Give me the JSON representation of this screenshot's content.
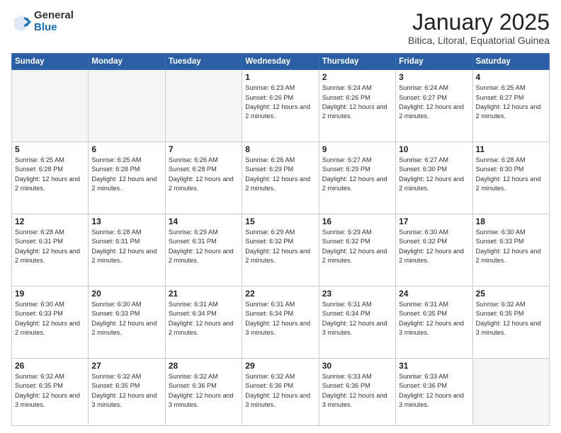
{
  "logo": {
    "general": "General",
    "blue": "Blue"
  },
  "header": {
    "month": "January 2025",
    "location": "Bitica, Litoral, Equatorial Guinea"
  },
  "days_of_week": [
    "Sunday",
    "Monday",
    "Tuesday",
    "Wednesday",
    "Thursday",
    "Friday",
    "Saturday"
  ],
  "weeks": [
    [
      {
        "day": "",
        "info": ""
      },
      {
        "day": "",
        "info": ""
      },
      {
        "day": "",
        "info": ""
      },
      {
        "day": "1",
        "info": "Sunrise: 6:23 AM\nSunset: 6:26 PM\nDaylight: 12 hours and 2 minutes."
      },
      {
        "day": "2",
        "info": "Sunrise: 6:24 AM\nSunset: 6:26 PM\nDaylight: 12 hours and 2 minutes."
      },
      {
        "day": "3",
        "info": "Sunrise: 6:24 AM\nSunset: 6:27 PM\nDaylight: 12 hours and 2 minutes."
      },
      {
        "day": "4",
        "info": "Sunrise: 6:25 AM\nSunset: 6:27 PM\nDaylight: 12 hours and 2 minutes."
      }
    ],
    [
      {
        "day": "5",
        "info": "Sunrise: 6:25 AM\nSunset: 6:28 PM\nDaylight: 12 hours and 2 minutes."
      },
      {
        "day": "6",
        "info": "Sunrise: 6:25 AM\nSunset: 6:28 PM\nDaylight: 12 hours and 2 minutes."
      },
      {
        "day": "7",
        "info": "Sunrise: 6:26 AM\nSunset: 6:28 PM\nDaylight: 12 hours and 2 minutes."
      },
      {
        "day": "8",
        "info": "Sunrise: 6:26 AM\nSunset: 6:29 PM\nDaylight: 12 hours and 2 minutes."
      },
      {
        "day": "9",
        "info": "Sunrise: 6:27 AM\nSunset: 6:29 PM\nDaylight: 12 hours and 2 minutes."
      },
      {
        "day": "10",
        "info": "Sunrise: 6:27 AM\nSunset: 6:30 PM\nDaylight: 12 hours and 2 minutes."
      },
      {
        "day": "11",
        "info": "Sunrise: 6:28 AM\nSunset: 6:30 PM\nDaylight: 12 hours and 2 minutes."
      }
    ],
    [
      {
        "day": "12",
        "info": "Sunrise: 6:28 AM\nSunset: 6:31 PM\nDaylight: 12 hours and 2 minutes."
      },
      {
        "day": "13",
        "info": "Sunrise: 6:28 AM\nSunset: 6:31 PM\nDaylight: 12 hours and 2 minutes."
      },
      {
        "day": "14",
        "info": "Sunrise: 6:29 AM\nSunset: 6:31 PM\nDaylight: 12 hours and 2 minutes."
      },
      {
        "day": "15",
        "info": "Sunrise: 6:29 AM\nSunset: 6:32 PM\nDaylight: 12 hours and 2 minutes."
      },
      {
        "day": "16",
        "info": "Sunrise: 6:29 AM\nSunset: 6:32 PM\nDaylight: 12 hours and 2 minutes."
      },
      {
        "day": "17",
        "info": "Sunrise: 6:30 AM\nSunset: 6:32 PM\nDaylight: 12 hours and 2 minutes."
      },
      {
        "day": "18",
        "info": "Sunrise: 6:30 AM\nSunset: 6:33 PM\nDaylight: 12 hours and 2 minutes."
      }
    ],
    [
      {
        "day": "19",
        "info": "Sunrise: 6:30 AM\nSunset: 6:33 PM\nDaylight: 12 hours and 2 minutes."
      },
      {
        "day": "20",
        "info": "Sunrise: 6:30 AM\nSunset: 6:33 PM\nDaylight: 12 hours and 2 minutes."
      },
      {
        "day": "21",
        "info": "Sunrise: 6:31 AM\nSunset: 6:34 PM\nDaylight: 12 hours and 2 minutes."
      },
      {
        "day": "22",
        "info": "Sunrise: 6:31 AM\nSunset: 6:34 PM\nDaylight: 12 hours and 3 minutes."
      },
      {
        "day": "23",
        "info": "Sunrise: 6:31 AM\nSunset: 6:34 PM\nDaylight: 12 hours and 3 minutes."
      },
      {
        "day": "24",
        "info": "Sunrise: 6:31 AM\nSunset: 6:35 PM\nDaylight: 12 hours and 3 minutes."
      },
      {
        "day": "25",
        "info": "Sunrise: 6:32 AM\nSunset: 6:35 PM\nDaylight: 12 hours and 3 minutes."
      }
    ],
    [
      {
        "day": "26",
        "info": "Sunrise: 6:32 AM\nSunset: 6:35 PM\nDaylight: 12 hours and 3 minutes."
      },
      {
        "day": "27",
        "info": "Sunrise: 6:32 AM\nSunset: 6:35 PM\nDaylight: 12 hours and 3 minutes."
      },
      {
        "day": "28",
        "info": "Sunrise: 6:32 AM\nSunset: 6:36 PM\nDaylight: 12 hours and 3 minutes."
      },
      {
        "day": "29",
        "info": "Sunrise: 6:32 AM\nSunset: 6:36 PM\nDaylight: 12 hours and 3 minutes."
      },
      {
        "day": "30",
        "info": "Sunrise: 6:33 AM\nSunset: 6:36 PM\nDaylight: 12 hours and 3 minutes."
      },
      {
        "day": "31",
        "info": "Sunrise: 6:33 AM\nSunset: 6:36 PM\nDaylight: 12 hours and 3 minutes."
      },
      {
        "day": "",
        "info": ""
      }
    ]
  ]
}
